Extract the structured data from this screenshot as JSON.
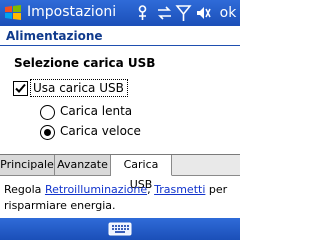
{
  "titlebar": {
    "title": "Impostazioni",
    "ok_label": "ok",
    "icons": [
      "start-icon",
      "connectivity-icon",
      "sync-icon",
      "signal-icon",
      "volume-icon"
    ]
  },
  "page": {
    "title": "Alimentazione"
  },
  "usb": {
    "section_title": "Selezione carica USB",
    "checkbox_label": "Usa carica USB",
    "checkbox_checked": true,
    "options": [
      {
        "label": "Carica lenta",
        "selected": false
      },
      {
        "label": "Carica veloce",
        "selected": true
      }
    ]
  },
  "tabs": [
    {
      "label": "Principale",
      "active": false
    },
    {
      "label": "Avanzate",
      "active": false
    },
    {
      "label": "Carica USB",
      "active": true
    }
  ],
  "info": {
    "prefix": "Regola ",
    "link1": "Retroilluminazione",
    "separator": ", ",
    "link2": "Trasmetti",
    "suffix": " per risparmiare energia."
  },
  "bottombar": {
    "icons": [
      "keyboard-icon"
    ]
  }
}
